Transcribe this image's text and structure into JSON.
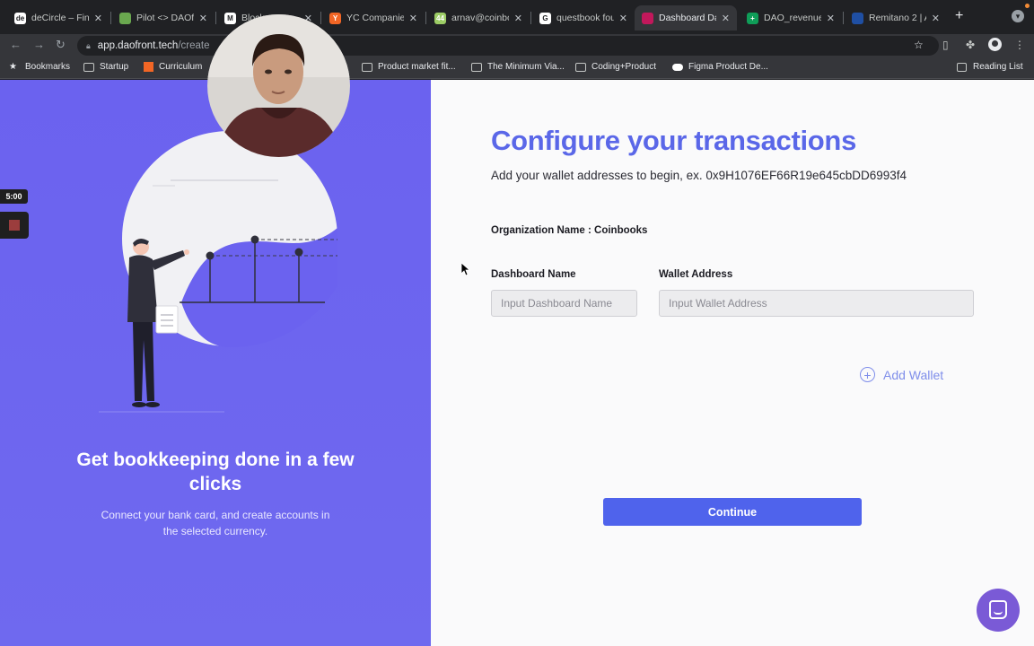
{
  "browser": {
    "tabs": [
      {
        "title": "deCircle – Fin",
        "favicon": "decircle-icon",
        "favicon_text": "de",
        "favicon_color": "#ffffff"
      },
      {
        "title": "Pilot <> DAOfr",
        "favicon": "pilot-icon",
        "favicon_text": "",
        "favicon_color": "#6aa84f"
      },
      {
        "title": "Blockc...",
        "favicon": "medium-icon",
        "favicon_text": "M",
        "favicon_color": "#ffffff"
      },
      {
        "title": "YC Companies",
        "favicon": "yc-icon",
        "favicon_text": "Y",
        "favicon_color": "#f26625"
      },
      {
        "title": "arnav@coinbo",
        "favicon": "mail-icon",
        "favicon_text": "44",
        "favicon_color": "#9ccc65"
      },
      {
        "title": "questbook fou",
        "favicon": "google-icon",
        "favicon_text": "G",
        "favicon_color": "#ffffff"
      },
      {
        "title": "Dashboard Da",
        "favicon": "daofront-icon",
        "favicon_text": "",
        "favicon_color": "#c2185b",
        "active": true
      },
      {
        "title": "DAO_revenue",
        "favicon": "sheets-icon",
        "favicon_text": "+",
        "favicon_color": "#0f9d58"
      },
      {
        "title": "Remitano 2 | A",
        "favicon": "remitano-icon",
        "favicon_text": "",
        "favicon_color": "#1f4fa3"
      }
    ],
    "close_glyph": "✕",
    "new_tab_glyph": "+",
    "url_host": "app.daofront.tech",
    "url_path": "/create",
    "bookmarks": [
      {
        "label": "Bookmarks",
        "icon": "star-icon"
      },
      {
        "label": "Startup",
        "icon": "folder-icon"
      },
      {
        "label": "Curriculum",
        "icon": "yc-icon"
      },
      {
        "label": "Product market fit...",
        "icon": "folder-icon"
      },
      {
        "label": "The Minimum Via...",
        "icon": "folder-icon"
      },
      {
        "label": "Coding+Product",
        "icon": "folder-icon"
      },
      {
        "label": "Figma Product De...",
        "icon": "figma-icon"
      }
    ],
    "reading_list": "Reading List"
  },
  "overlay": {
    "timer": "5:00"
  },
  "promo": {
    "title": "Get bookkeeping done in a few clicks",
    "subtitle": "Connect your bank card, and create accounts in the selected currency."
  },
  "form": {
    "heading": "Configure your transactions",
    "subheading": "Add your wallet addresses to begin, ex. 0x9H1076EF66R19e645cbDD6993f4",
    "org_label": "Organization Name : Coinbooks",
    "dashboard_label": "Dashboard Name",
    "dashboard_value": "",
    "dashboard_placeholder": "Input Dashboard Name",
    "wallet_label": "Wallet Address",
    "wallet_value": "",
    "wallet_placeholder": "Input Wallet Address",
    "add_wallet": "Add Wallet",
    "continue": "Continue"
  },
  "colors": {
    "brand_primary": "#4f63ec",
    "heading": "#5a67e8",
    "left_panel": "#6b62ef",
    "chat_widget": "#7a5ad6"
  }
}
